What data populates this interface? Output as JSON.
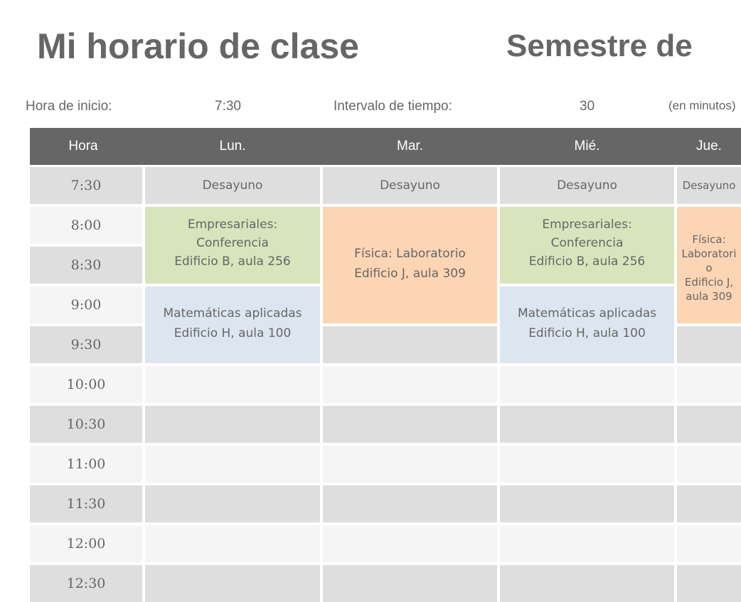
{
  "title": "Mi horario de clase",
  "semester": "Semestre de",
  "start_label": "Hora de inicio:",
  "start_value": "7:30",
  "interval_label": "Intervalo de tiempo:",
  "interval_value": "30",
  "interval_unit": "(en minutos)",
  "colors": {
    "header": "#666666",
    "row_dark": "#dedede",
    "row_light": "#f5f5f5",
    "green": "#d8e4bc",
    "orange": "#fcd5b4",
    "blue": "#dce6f1"
  },
  "columns": [
    "Hora",
    "Lun.",
    "Mar.",
    "Mié.",
    "Jue."
  ],
  "times": [
    "7:30",
    "8:00",
    "8:30",
    "9:00",
    "9:30",
    "10:00",
    "10:30",
    "11:00",
    "11:30",
    "12:00",
    "12:30"
  ],
  "events": [
    {
      "day": 1,
      "start": 0,
      "span": 1,
      "lines": [
        "Desayuno"
      ],
      "color": "none"
    },
    {
      "day": 2,
      "start": 0,
      "span": 1,
      "lines": [
        "Desayuno"
      ],
      "color": "none"
    },
    {
      "day": 3,
      "start": 0,
      "span": 1,
      "lines": [
        "Desayuno"
      ],
      "color": "none"
    },
    {
      "day": 4,
      "start": 0,
      "span": 1,
      "lines": [
        "Desayuno"
      ],
      "color": "none"
    },
    {
      "day": 1,
      "start": 1,
      "span": 2,
      "lines": [
        "Empresariales:",
        "Conferencia",
        "Edificio B, aula 256"
      ],
      "color": "green"
    },
    {
      "day": 1,
      "start": 3,
      "span": 2,
      "lines": [
        "Matemáticas aplicadas",
        "Edificio H, aula 100"
      ],
      "color": "blue"
    },
    {
      "day": 2,
      "start": 1,
      "span": 3,
      "lines": [
        "Física: Laboratorio",
        "Edificio J, aula 309"
      ],
      "color": "orange"
    },
    {
      "day": 3,
      "start": 1,
      "span": 2,
      "lines": [
        "Empresariales:",
        "Conferencia",
        "Edificio B, aula 256"
      ],
      "color": "green"
    },
    {
      "day": 3,
      "start": 3,
      "span": 2,
      "lines": [
        "Matemáticas aplicadas",
        "Edificio H, aula 100"
      ],
      "color": "blue"
    },
    {
      "day": 4,
      "start": 1,
      "span": 3,
      "lines": [
        "Física: Laboratorio",
        "Edificio J, aula 309"
      ],
      "color": "orange"
    }
  ]
}
